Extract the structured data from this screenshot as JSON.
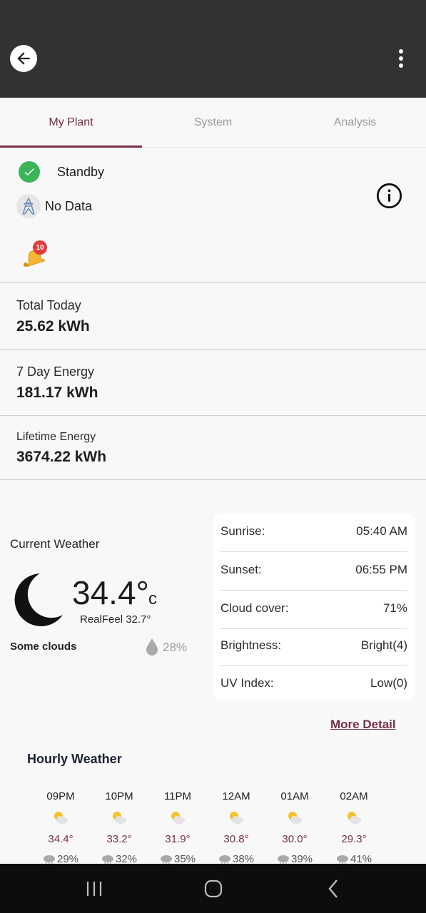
{
  "tabs": [
    {
      "label": "My Plant",
      "active": true
    },
    {
      "label": "System",
      "active": false
    },
    {
      "label": "Analysis",
      "active": false
    }
  ],
  "status": {
    "state": "Standby",
    "grid": "No Data",
    "alarm_count": "10"
  },
  "energy": {
    "today_label": "Total Today",
    "today_value": "25.62 kWh",
    "week_label": "7 Day Energy",
    "week_value": "181.17 kWh",
    "lifetime_label": "Lifetime Energy",
    "lifetime_value": "3674.22 kWh"
  },
  "weather": {
    "title": "Current Weather",
    "temp": "34.4°",
    "unit": "c",
    "realfeel": "RealFeel 32.7°",
    "condition": "Some clouds",
    "humidity": "28%",
    "details": [
      {
        "label": "Sunrise:",
        "value": "05:40 AM"
      },
      {
        "label": "Sunset:",
        "value": "06:55 PM"
      },
      {
        "label": "Cloud cover:",
        "value": "71%"
      },
      {
        "label": "Brightness:",
        "value": "Bright(4)"
      },
      {
        "label": "UV Index:",
        "value": "Low(0)"
      }
    ],
    "more_detail": "More Detail"
  },
  "hourly": {
    "title": "Hourly Weather",
    "items": [
      {
        "time": "09PM",
        "temp": "34.4°",
        "rain": "29%"
      },
      {
        "time": "10PM",
        "temp": "33.2°",
        "rain": "32%"
      },
      {
        "time": "11PM",
        "temp": "31.9°",
        "rain": "35%"
      },
      {
        "time": "12AM",
        "temp": "30.8°",
        "rain": "38%"
      },
      {
        "time": "01AM",
        "temp": "30.0°",
        "rain": "39%"
      },
      {
        "time": "02AM",
        "temp": "29.3°",
        "rain": "41%"
      }
    ]
  },
  "icons": {
    "back": "arrow-left-icon",
    "more": "more-vert-icon",
    "status": "check-circle-icon",
    "grid": "transmission-tower-icon",
    "info": "info-icon",
    "alarm": "bell-icon",
    "weather": "moon-icon",
    "humidity": "water-drop-icon",
    "hour": "partly-cloudy-night-icon",
    "rain": "rain-cloud-icon"
  },
  "colors": {
    "accent": "#7a2f44",
    "appbar": "#323232",
    "success": "#3cb55a",
    "badge": "#e13b3b"
  }
}
